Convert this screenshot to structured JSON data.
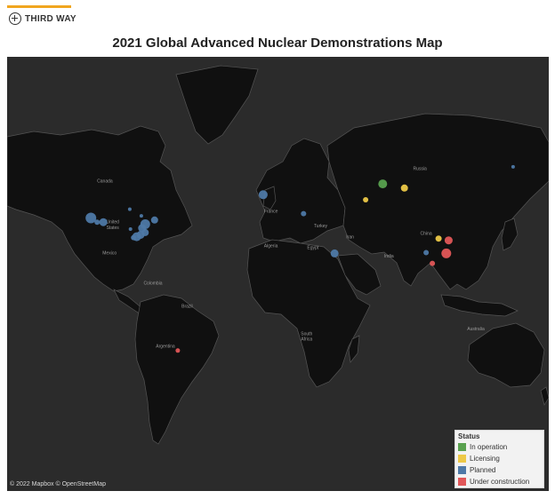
{
  "header": {
    "logo_text": "THIRD WAY",
    "title": "2021 Global Advanced Nuclear Demonstrations Map"
  },
  "map": {
    "attribution": "© 2022 Mapbox © OpenStreetMap",
    "labels": [
      {
        "name": "Canada",
        "lon": -105,
        "lat": 58
      },
      {
        "name": "United",
        "lon": -100,
        "lat": 41
      },
      {
        "name": "States",
        "lon": -100,
        "lat": 38
      },
      {
        "name": "Mexico",
        "lon": -102,
        "lat": 24
      },
      {
        "name": "Colombia",
        "lon": -74,
        "lat": 5
      },
      {
        "name": "Brazil",
        "lon": -52,
        "lat": -10
      },
      {
        "name": "Argentina",
        "lon": -66,
        "lat": -34
      },
      {
        "name": "France",
        "lon": 2,
        "lat": 46
      },
      {
        "name": "Algeria",
        "lon": 2,
        "lat": 28
      },
      {
        "name": "Turkey",
        "lon": 34,
        "lat": 39
      },
      {
        "name": "Iran",
        "lon": 53,
        "lat": 33
      },
      {
        "name": "Egypt",
        "lon": 29,
        "lat": 27
      },
      {
        "name": "India",
        "lon": 78,
        "lat": 22
      },
      {
        "name": "China",
        "lon": 102,
        "lat": 35
      },
      {
        "name": "Russia",
        "lon": 98,
        "lat": 62
      },
      {
        "name": "South",
        "lon": 25,
        "lat": -27
      },
      {
        "name": "Africa",
        "lon": 25,
        "lat": -30
      },
      {
        "name": "Australia",
        "lon": 134,
        "lat": -24
      }
    ]
  },
  "legend": {
    "title": "Status",
    "items": [
      {
        "label": "In operation",
        "color": "#59a14f"
      },
      {
        "label": "Licensing",
        "color": "#edc948"
      },
      {
        "label": "Planned",
        "color": "#4e79a7"
      },
      {
        "label": "Under construction",
        "color": "#e15759"
      }
    ]
  },
  "projects": [
    {
      "status": "Planned",
      "lon": -114,
      "lat": 43.5,
      "size": 6
    },
    {
      "status": "Planned",
      "lon": -110,
      "lat": 41.5,
      "size": 3
    },
    {
      "status": "Planned",
      "lon": -106,
      "lat": 41.5,
      "size": 4.5
    },
    {
      "status": "Planned",
      "lon": -89,
      "lat": 47.5,
      "size": 2
    },
    {
      "status": "Planned",
      "lon": -73,
      "lat": 42.5,
      "size": 4
    },
    {
      "status": "Planned",
      "lon": -79,
      "lat": 40.5,
      "size": 5.5
    },
    {
      "status": "Planned",
      "lon": -81,
      "lat": 38.5,
      "size": 4.5
    },
    {
      "status": "Planned",
      "lon": -79,
      "lat": 36.2,
      "size": 4
    },
    {
      "status": "Planned",
      "lon": -82,
      "lat": 35,
      "size": 4.5
    },
    {
      "status": "Planned",
      "lon": -84.5,
      "lat": 34,
      "size": 5
    },
    {
      "status": "Planned",
      "lon": -86.5,
      "lat": 33.5,
      "size": 3
    },
    {
      "status": "Planned",
      "lon": -88.5,
      "lat": 38,
      "size": 2
    },
    {
      "status": "Planned",
      "lon": -81.5,
      "lat": 44.5,
      "size": 2
    },
    {
      "status": "Planned",
      "lon": -3,
      "lat": 53.5,
      "size": 5
    },
    {
      "status": "Planned",
      "lon": 23,
      "lat": 45.5,
      "size": 3
    },
    {
      "status": "Planned",
      "lon": 43,
      "lat": 24.5,
      "size": 4.5
    },
    {
      "status": "Planned",
      "lon": 102,
      "lat": 25,
      "size": 3
    },
    {
      "status": "Planned",
      "lon": 158,
      "lat": 63,
      "size": 2
    },
    {
      "status": "In operation",
      "lon": 74,
      "lat": 57.5,
      "size": 5
    },
    {
      "status": "Licensing",
      "lon": 63,
      "lat": 51.5,
      "size": 3
    },
    {
      "status": "Licensing",
      "lon": 88,
      "lat": 56,
      "size": 4
    },
    {
      "status": "Licensing",
      "lon": 110,
      "lat": 33,
      "size": 3.5
    },
    {
      "status": "Under construction",
      "lon": 116.5,
      "lat": 32,
      "size": 4.5
    },
    {
      "status": "Under construction",
      "lon": 115,
      "lat": 24.5,
      "size": 5.5
    },
    {
      "status": "Under construction",
      "lon": 106,
      "lat": 18.5,
      "size": 3
    },
    {
      "status": "Under construction",
      "lon": -58,
      "lat": -35.5,
      "size": 2.5
    }
  ]
}
